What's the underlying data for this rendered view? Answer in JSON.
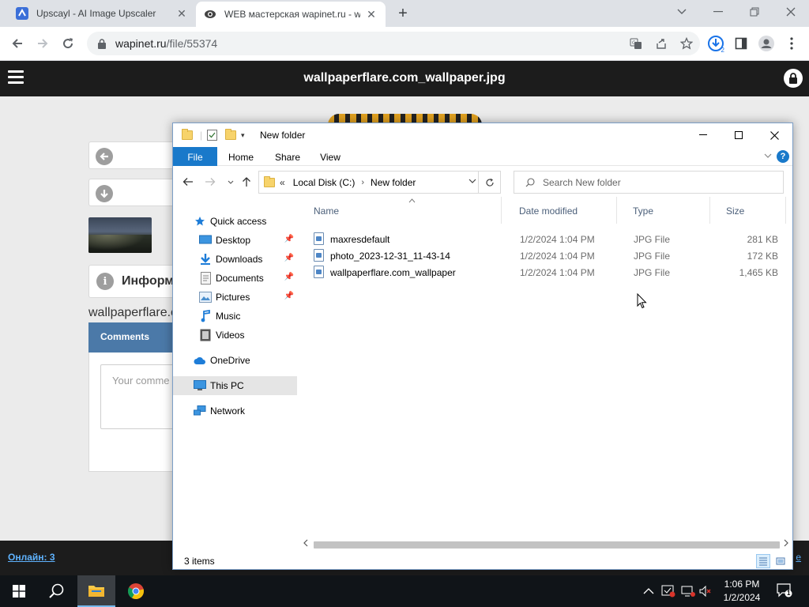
{
  "browser": {
    "tabs": [
      {
        "title": "Upscayl - AI Image Upscaler",
        "favicon": "upscayl-icon",
        "active": false
      },
      {
        "title": "WEB мастерская wapinet.ru - wa",
        "favicon": "wapinet-icon",
        "active": true
      }
    ],
    "url_host": "wapinet.ru",
    "url_path": "/file/55374",
    "download_badge": "2"
  },
  "site": {
    "title": "wallpaperflare.com_wallpaper.jpg",
    "info_label": "Информ",
    "filename_text": "wallpaperflare.c",
    "comments_heading": "Comments",
    "comment_placeholder": "Your comme",
    "online_label": "Онлайн: 3",
    "footer_right": "e"
  },
  "explorer": {
    "window_title": "New folder",
    "ribbon_tabs": [
      "File",
      "Home",
      "Share",
      "View"
    ],
    "address": {
      "prefix": "«",
      "crumbs": [
        "Local Disk (C:)",
        "New folder"
      ]
    },
    "search_placeholder": "Search New folder",
    "nav": [
      {
        "label": "Quick access",
        "icon": "star-icon"
      },
      {
        "label": "Desktop",
        "icon": "desktop-icon",
        "pinned": true
      },
      {
        "label": "Downloads",
        "icon": "download-icon",
        "pinned": true
      },
      {
        "label": "Documents",
        "icon": "documents-icon",
        "pinned": true
      },
      {
        "label": "Pictures",
        "icon": "pictures-icon",
        "pinned": true
      },
      {
        "label": "Music",
        "icon": "music-icon"
      },
      {
        "label": "Videos",
        "icon": "videos-icon"
      },
      {
        "label": "OneDrive",
        "icon": "cloud-icon"
      },
      {
        "label": "This PC",
        "icon": "pc-icon",
        "selected": true
      },
      {
        "label": "Network",
        "icon": "network-icon"
      }
    ],
    "columns": [
      "Name",
      "Date modified",
      "Type",
      "Size"
    ],
    "files": [
      {
        "name": "maxresdefault",
        "date": "1/2/2024 1:04 PM",
        "type": "JPG File",
        "size": "281 KB"
      },
      {
        "name": "photo_2023-12-31_11-43-14",
        "date": "1/2/2024 1:04 PM",
        "type": "JPG File",
        "size": "172 KB"
      },
      {
        "name": "wallpaperflare.com_wallpaper",
        "date": "1/2/2024 1:04 PM",
        "type": "JPG File",
        "size": "1,465 KB"
      }
    ],
    "status": "3 items"
  },
  "taskbar": {
    "time": "1:06 PM",
    "date": "1/2/2024",
    "notification_count": "1"
  },
  "colors": {
    "explorer_accent": "#1979ca",
    "comments_header": "#4b79a8",
    "site_dark": "#1c1c1c",
    "online_link": "#5fb3ff"
  }
}
